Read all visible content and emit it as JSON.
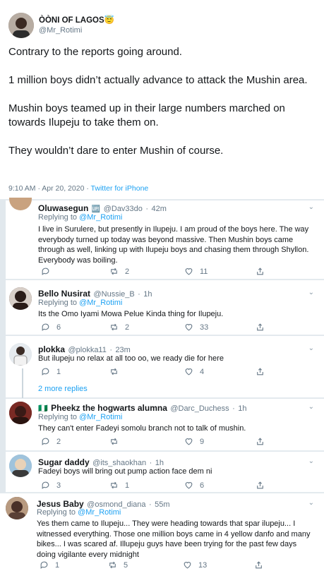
{
  "main": {
    "author_name": "ÒÒNI OF LAGOS",
    "author_emoji": "😇",
    "author_handle": "@Mr_Rotimi",
    "paragraphs": [
      "Contrary to the reports going around.",
      "1 million boys didn’t actually advance to attack the Mushin area.",
      "Mushin boys teamed up in their large numbers marched on towards Ilupeju to take them on.",
      "They wouldn’t dare to enter Mushin of course."
    ],
    "time": "9:10 AM · Apr 20, 2020 · ",
    "source": "Twitter for iPhone"
  },
  "replying_prefix": "Replying to ",
  "replies": [
    {
      "name": "Oluwasegun",
      "badge": "🆙",
      "handle": "@Dav33do",
      "time": "42m",
      "replying_to": "@Mr_Rotimi",
      "text": "I live in Surulere, but presently in Ilupeju. I am proud of the boys here. The way everybody turned up today was beyond massive. Then Mushin boys came through as well, linking up with Ilupeju boys and chasing them through Shyllon. Everybody was boiling.",
      "reply_count": "",
      "retweet_count": "2",
      "like_count": "11"
    },
    {
      "name": "Bello Nusirat",
      "handle": "@Nussie_B",
      "time": "1h",
      "replying_to": "@Mr_Rotimi",
      "text": "Its the Omo Iyami Mowa Pelue Kinda thing for Ilupeju.",
      "reply_count": "6",
      "retweet_count": "2",
      "like_count": "33"
    },
    {
      "name": "plokka",
      "handle": "@plokka11",
      "time": "23m",
      "replying_to": "",
      "text": "But ilupeju no relax at all too oo, we ready die for here",
      "reply_count": "1",
      "retweet_count": "",
      "like_count": "4"
    },
    {
      "name": "Pheekz the hogwarts alumna",
      "flag": "🇳🇬",
      "handle": "@Darc_Duchess",
      "time": "1h",
      "replying_to": "@Mr_Rotimi",
      "text": "They can't enter Fadeyi somolu branch not to talk of mushin.",
      "reply_count": "2",
      "retweet_count": "",
      "like_count": "9"
    },
    {
      "name": "Sugar daddy",
      "handle": "@its_shaokhan",
      "time": "1h",
      "replying_to": "",
      "text": "Fadeyi boys will bring out pump action face dem ni",
      "reply_count": "3",
      "retweet_count": "1",
      "like_count": "6"
    },
    {
      "name": "Jesus Baby",
      "handle": "@osmond_diana",
      "time": "55m",
      "replying_to": "@Mr_Rotimi",
      "text": "Yes them came to Ilupeju... They were heading towards that spar ilupeju... I witnessed everything. Those one million boys came in 4 yellow danfo and many bikes... I was scared af. Illupeju guys have been trying for the past few days doing vigilante every midnight",
      "reply_count": "1",
      "retweet_count": "5",
      "like_count": "13"
    }
  ],
  "more_replies": "2 more replies",
  "colors": {
    "link": "#1da1f2",
    "muted": "#657786",
    "divider": "#e6ecf0",
    "background": "#e1e8ed"
  }
}
